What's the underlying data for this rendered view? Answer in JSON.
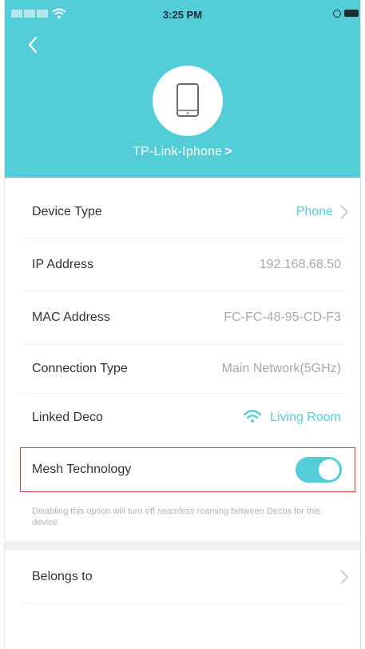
{
  "status_bar": {
    "time": "3:25 PM"
  },
  "header": {
    "device_name": "TP-Link-Iphone",
    "name_chevron": ">",
    "background": "#53cdd8"
  },
  "details": {
    "device_type": {
      "label": "Device Type",
      "value": "Phone"
    },
    "ip_address": {
      "label": "IP Address",
      "value": "192.168.68.50"
    },
    "mac_address": {
      "label": "MAC Address",
      "value": "FC-FC-48-95-CD-F3"
    },
    "connection_type": {
      "label": "Connection Type",
      "value": "Main Network(5GHz)"
    },
    "linked_deco": {
      "label": "Linked Deco",
      "value": "Living Room"
    }
  },
  "mesh": {
    "label": "Mesh Technology",
    "enabled": true,
    "note": "Disabling this option will turn off seamless roaming between Decos for this device."
  },
  "belongs_to": {
    "label": "Belongs to"
  },
  "icons": {
    "back": "back-chevron-icon",
    "device": "phone-icon",
    "wifi": "wifi-icon",
    "chevron": "chevron-right-icon"
  },
  "colors": {
    "accent": "#53cdd8",
    "highlight_border": "#d93a3a"
  }
}
